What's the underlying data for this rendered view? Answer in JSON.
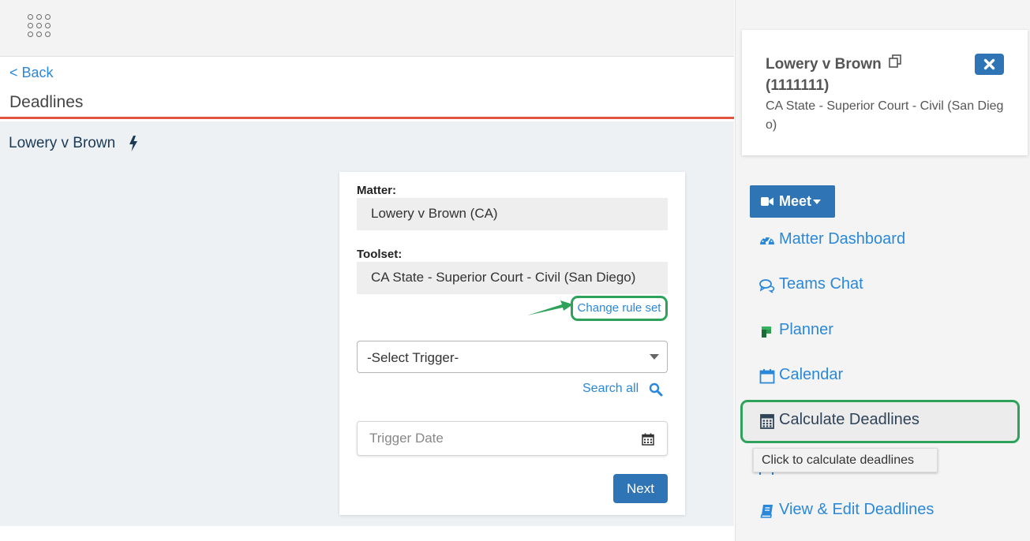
{
  "colors": {
    "accent": "#2f74b5",
    "link": "#2b88d8",
    "header_rule": "#e0533d",
    "highlight": "#2ea25a"
  },
  "header": {
    "back_label": "< Back",
    "page_title": "Deadlines"
  },
  "main": {
    "matter_heading": "Lowery v Brown",
    "form": {
      "matter_label": "Matter:",
      "matter_value": "Lowery v Brown (CA)",
      "toolset_label": "Toolset:",
      "toolset_value": "CA State - Superior Court - Civil (San Diego)",
      "change_rule_set": "Change rule set",
      "trigger_select_value": "-Select Trigger-",
      "search_all": "Search all",
      "trigger_date_placeholder": "Trigger Date",
      "next_label": "Next"
    }
  },
  "sidebar": {
    "matter_title": "Lowery v Brown",
    "matter_number": "(1111111)",
    "matter_court": "CA State - Superior Court - Civil (San Diego)",
    "meet_label": "Meet",
    "nav": [
      {
        "label": "Matter Dashboard",
        "icon": "dashboard-icon"
      },
      {
        "label": "Teams Chat",
        "icon": "chat-icon"
      },
      {
        "label": "Planner",
        "icon": "planner-icon"
      },
      {
        "label": "Calendar",
        "icon": "calendar-icon"
      },
      {
        "label": "Calculate Deadlines",
        "icon": "calculator-icon"
      },
      {
        "label": "View & Edit Deadlines",
        "icon": "book-icon"
      }
    ],
    "tooltip": "Click to calculate deadlines"
  }
}
